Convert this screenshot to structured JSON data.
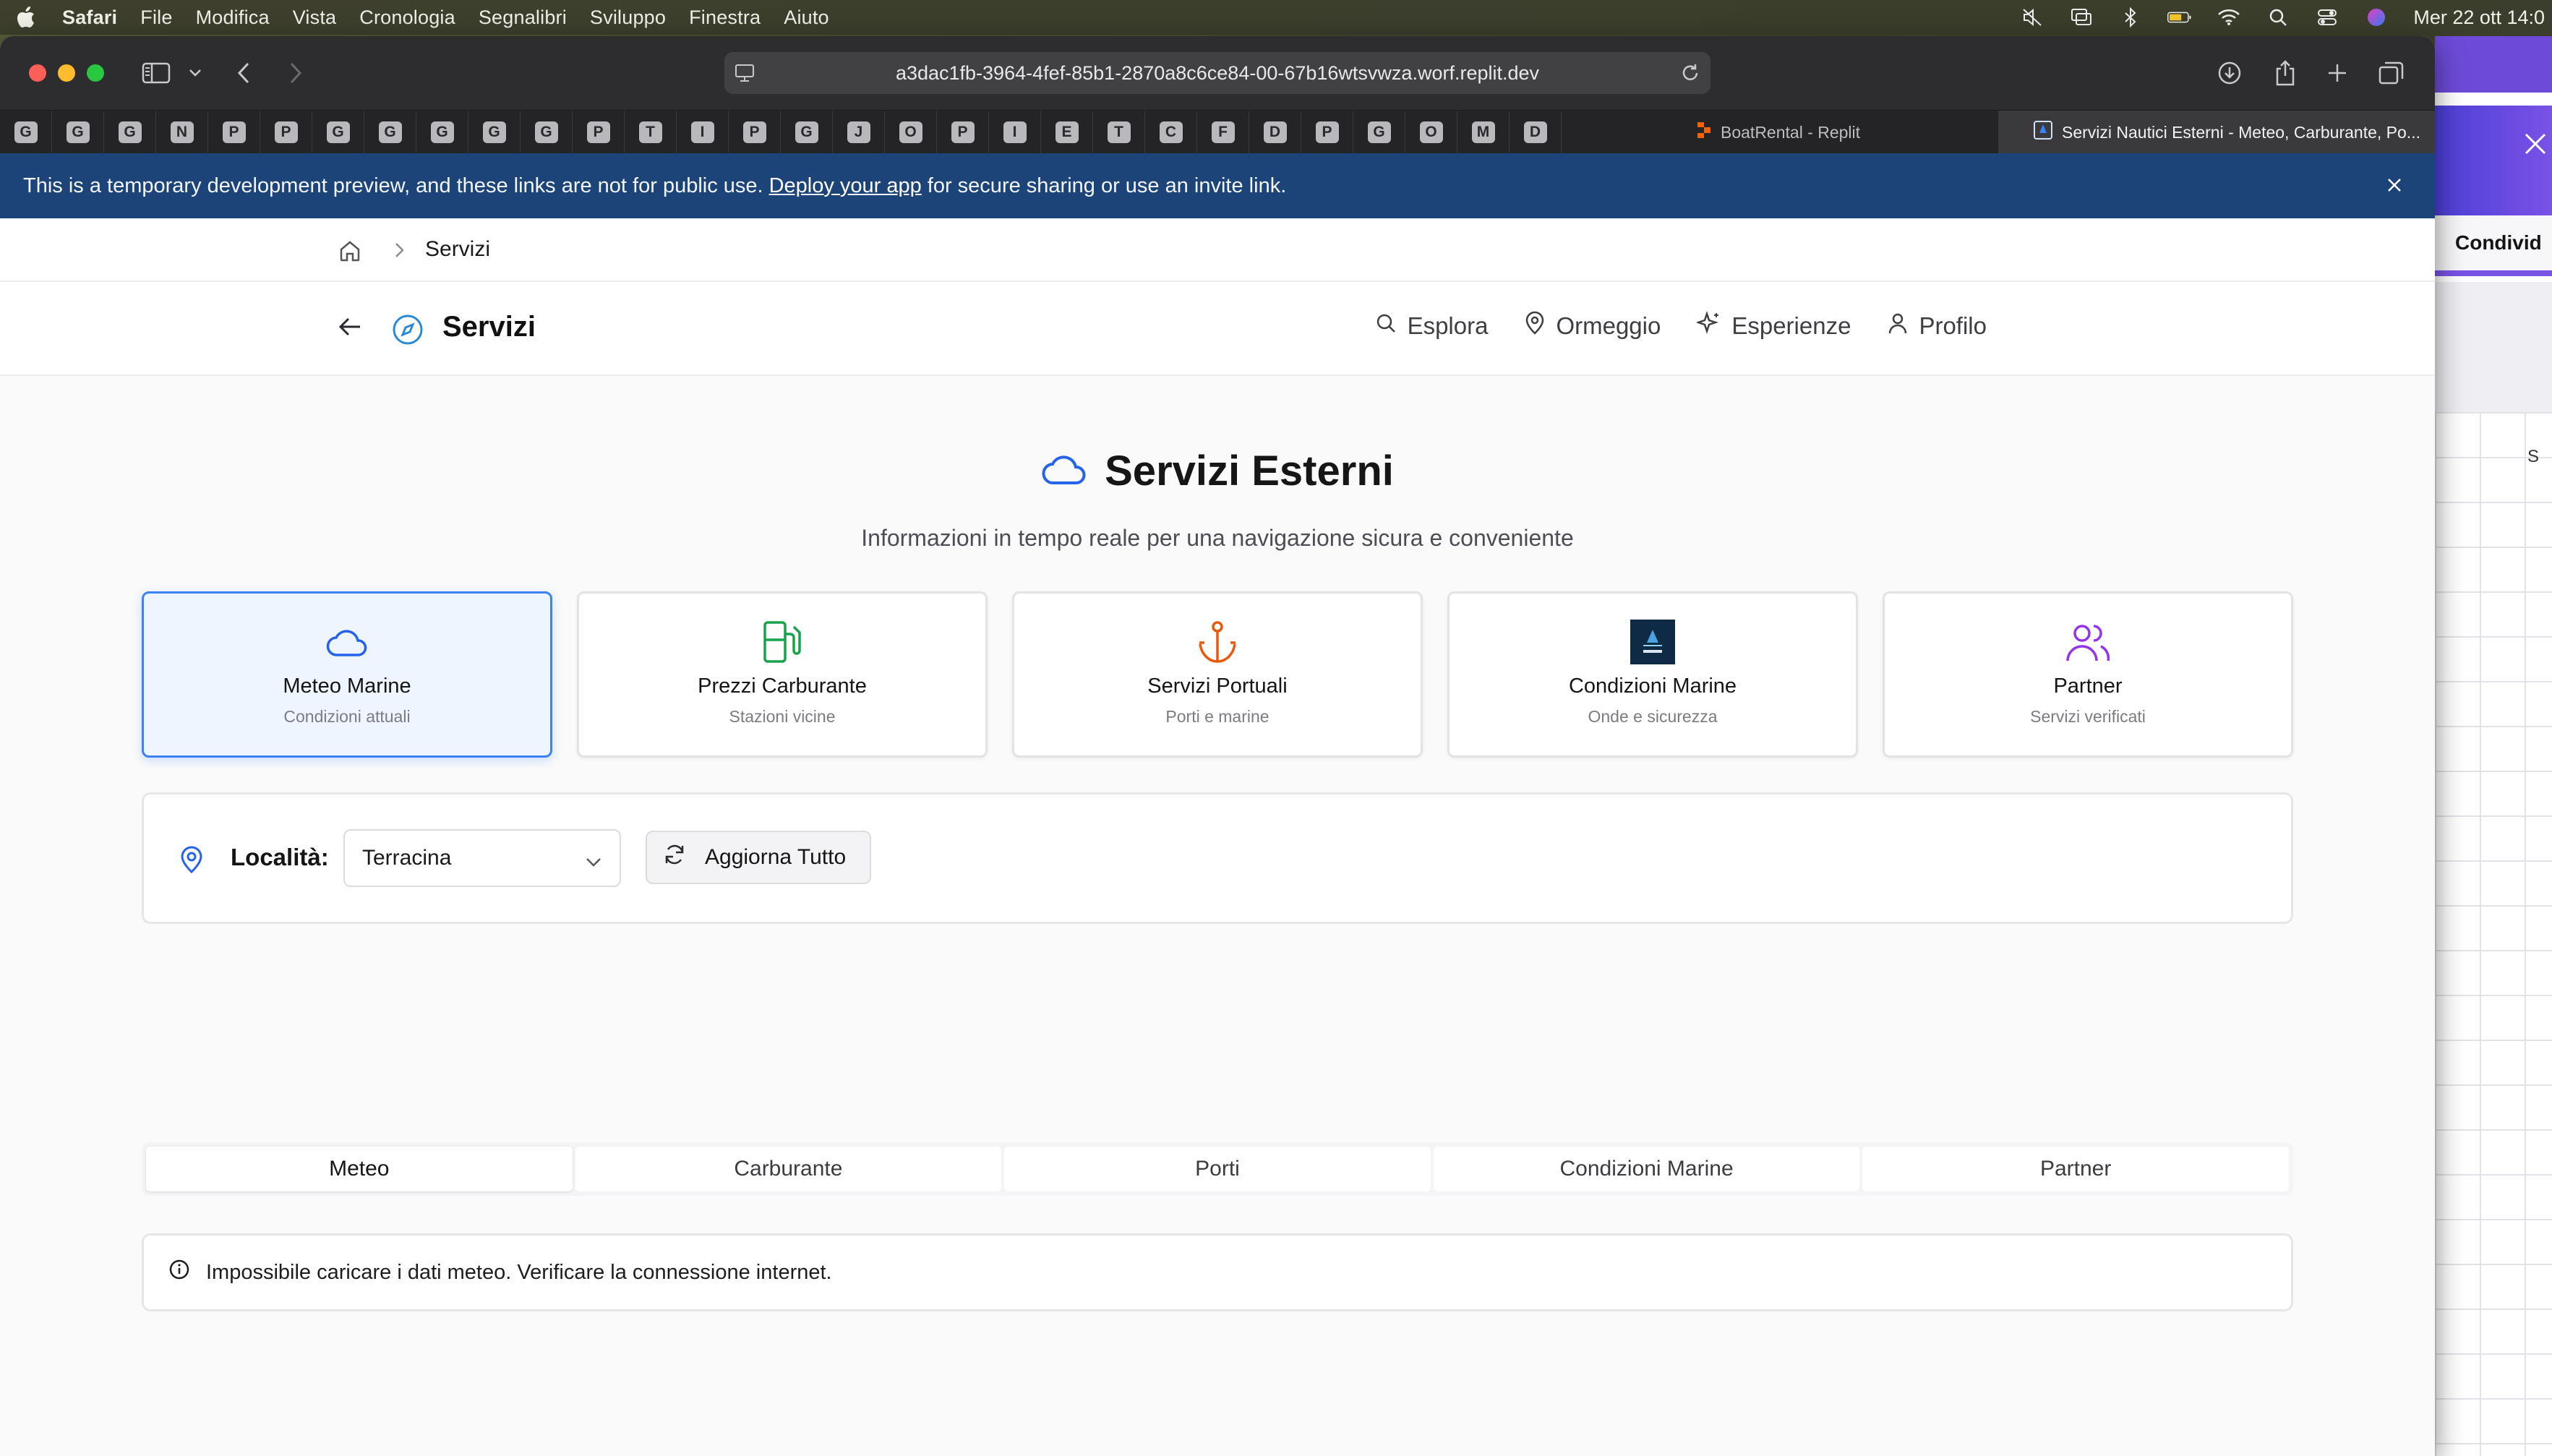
{
  "menubar": {
    "app": "Safari",
    "items": [
      "File",
      "Modifica",
      "Vista",
      "Cronologia",
      "Segnalibri",
      "Sviluppo",
      "Finestra",
      "Aiuto"
    ],
    "clock": "Mer 22 ott  14:0"
  },
  "browser": {
    "url": "a3dac1fb-3964-4fef-85b1-2870a8c6ce84-00-67b16wtsvwza.worf.replit.dev",
    "favicon_tabs": [
      "G",
      "G",
      "G",
      "N",
      "P",
      "P",
      "G",
      "G",
      "G",
      "G",
      "G",
      "P",
      "T",
      "I",
      "P",
      "G",
      "J",
      "O",
      "P",
      "I",
      "E",
      "T",
      "C",
      "F",
      "D",
      "P",
      "G",
      "O",
      "M",
      "D"
    ],
    "tab_replit": "BoatRental - Replit",
    "tab_active": "Servizi Nautici Esterni - Meteo, Carburante, Po..."
  },
  "banner": {
    "text_before": "This is a temporary development preview, and these links are not for public use.",
    "link": "Deploy your app",
    "text_after": "for secure sharing or use an invite link."
  },
  "breadcrumb": {
    "current": "Servizi"
  },
  "header": {
    "title": "Servizi",
    "nav": [
      {
        "label": "Esplora",
        "icon": "search-icon"
      },
      {
        "label": "Ormeggio",
        "icon": "map-pin-icon"
      },
      {
        "label": "Esperienze",
        "icon": "sparkles-icon"
      },
      {
        "label": "Profilo",
        "icon": "user-icon"
      }
    ]
  },
  "hero": {
    "title": "Servizi Esterni",
    "subtitle": "Informazioni in tempo reale per una navigazione sicura e conveniente"
  },
  "cards": [
    {
      "title": "Meteo Marine",
      "subtitle": "Condizioni attuali",
      "icon": "cloud-icon",
      "color": "#2563eb"
    },
    {
      "title": "Prezzi Carburante",
      "subtitle": "Stazioni vicine",
      "icon": "fuel-icon",
      "color": "#16a34a"
    },
    {
      "title": "Servizi Portuali",
      "subtitle": "Porti e marine",
      "icon": "anchor-icon",
      "color": "#ea580c"
    },
    {
      "title": "Condizioni Marine",
      "subtitle": "Onde e sicurezza",
      "icon": "seaboo-logo",
      "color": "#0f2a44"
    },
    {
      "title": "Partner",
      "subtitle": "Servizi verificati",
      "icon": "users-icon",
      "color": "#9333ea"
    }
  ],
  "filter": {
    "label": "Località:",
    "location": "Terracina",
    "refresh": "Aggiorna Tutto"
  },
  "tabs": [
    "Meteo",
    "Carburante",
    "Porti",
    "Condizioni Marine",
    "Partner"
  ],
  "alert": {
    "text": "Impossibile caricare i dati meteo. Verificare la connessione internet."
  },
  "background_window": {
    "share_label": "Condivid",
    "column_letter": "S"
  }
}
